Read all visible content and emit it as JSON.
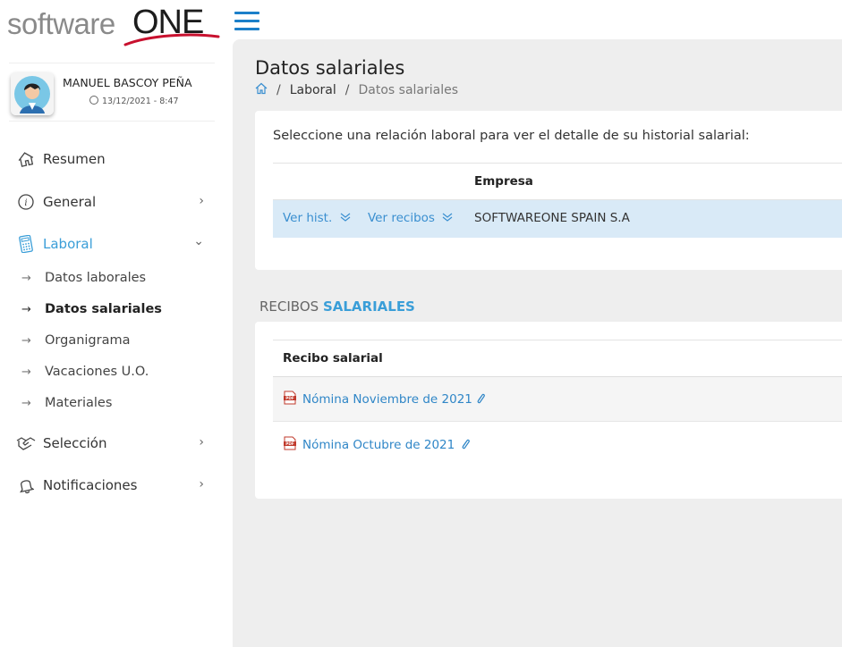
{
  "brand": {
    "logo_text": "softwareONE"
  },
  "user": {
    "name": "MANUEL BASCOY PEÑA",
    "timestamp": "13/12/2021 - 8:47"
  },
  "nav": {
    "items": [
      {
        "label": "Resumen",
        "icon": "house-icon"
      },
      {
        "label": "General",
        "icon": "info-icon"
      },
      {
        "label": "Laboral",
        "icon": "calculator-icon"
      },
      {
        "label": "Selección",
        "icon": "handshake-icon"
      },
      {
        "label": "Notificaciones",
        "icon": "bell-icon"
      }
    ],
    "laboral_subitems": [
      {
        "label": "Datos laborales"
      },
      {
        "label": "Datos salariales"
      },
      {
        "label": "Organigrama"
      },
      {
        "label": "Vacaciones U.O."
      },
      {
        "label": "Materiales"
      }
    ]
  },
  "page": {
    "title": "Datos salariales",
    "breadcrumb": [
      "Laboral",
      "Datos salariales"
    ]
  },
  "relations": {
    "intro": "Seleccione una relación laboral para ver el detalle de su historial salarial:",
    "column_company": "Empresa",
    "row": {
      "action_history": "Ver hist.",
      "action_receipts": "Ver recibos",
      "company": "SOFTWAREONE SPAIN S.A"
    }
  },
  "receipts": {
    "section_prefix": "RECIBOS",
    "section_accent": "SALARIALES",
    "column": "Recibo salarial",
    "items": [
      {
        "label": "Nómina Noviembre de 2021"
      },
      {
        "label": "Nómina Octubre de 2021"
      }
    ]
  },
  "colors": {
    "accent": "#3a9ed8",
    "link": "#2f86c7",
    "selected_row": "#d9eaf7",
    "main_bg": "#eeeeee",
    "logo_red": "#c8102e"
  }
}
